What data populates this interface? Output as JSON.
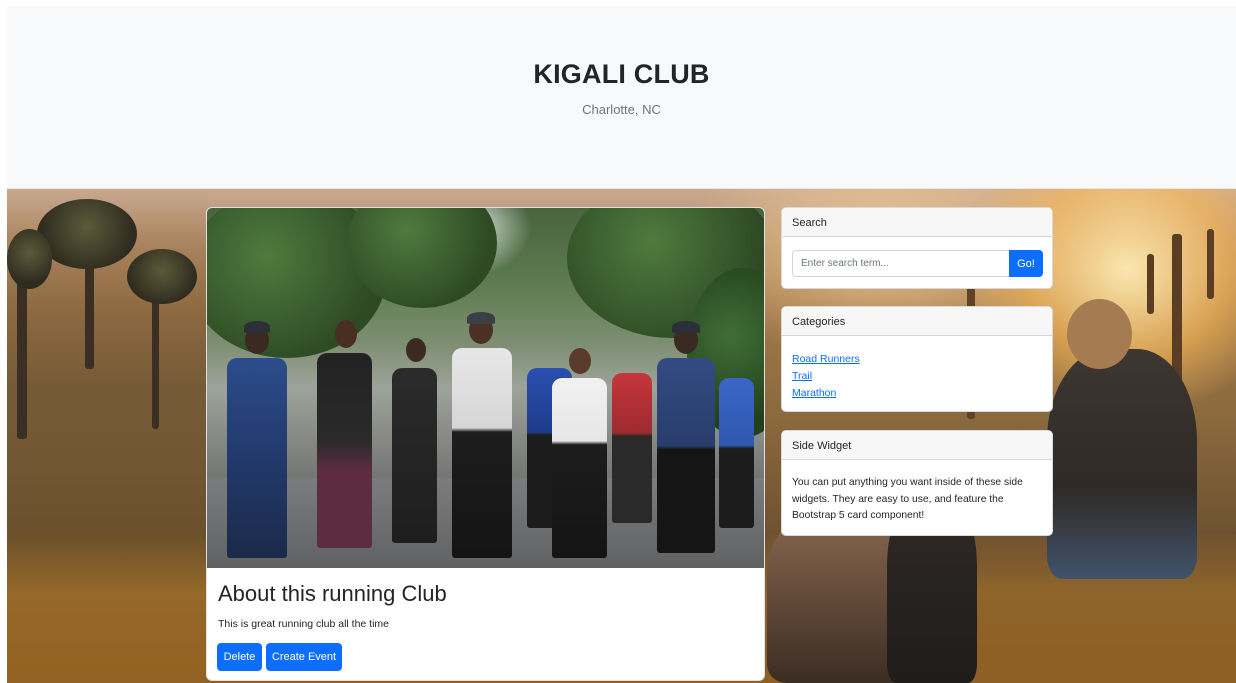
{
  "header": {
    "title": "KIGALI CLUB",
    "subtitle": "Charlotte, NC"
  },
  "main_card": {
    "image_icon": "running-club-photo",
    "title": "About this running Club",
    "text": "This is great running club all the time",
    "buttons": {
      "delete_label": "Delete",
      "create_event_label": "Create Event"
    }
  },
  "sidebar": {
    "search": {
      "header": "Search",
      "placeholder": "Enter search term...",
      "value": "",
      "button_label": "Go!"
    },
    "categories": {
      "header": "Categories",
      "items": [
        {
          "label": "Road Runners"
        },
        {
          "label": "Trail"
        },
        {
          "label": "Marathon"
        }
      ]
    },
    "side_widget": {
      "header": "Side Widget",
      "text": "You can put anything you want inside of these side widgets. They are easy to use, and feature the Bootstrap 5 card component!"
    }
  },
  "colors": {
    "primary": "#0d6efd",
    "header_bg": "#f8f9fa",
    "text": "#212529",
    "muted": "#6c757d"
  }
}
